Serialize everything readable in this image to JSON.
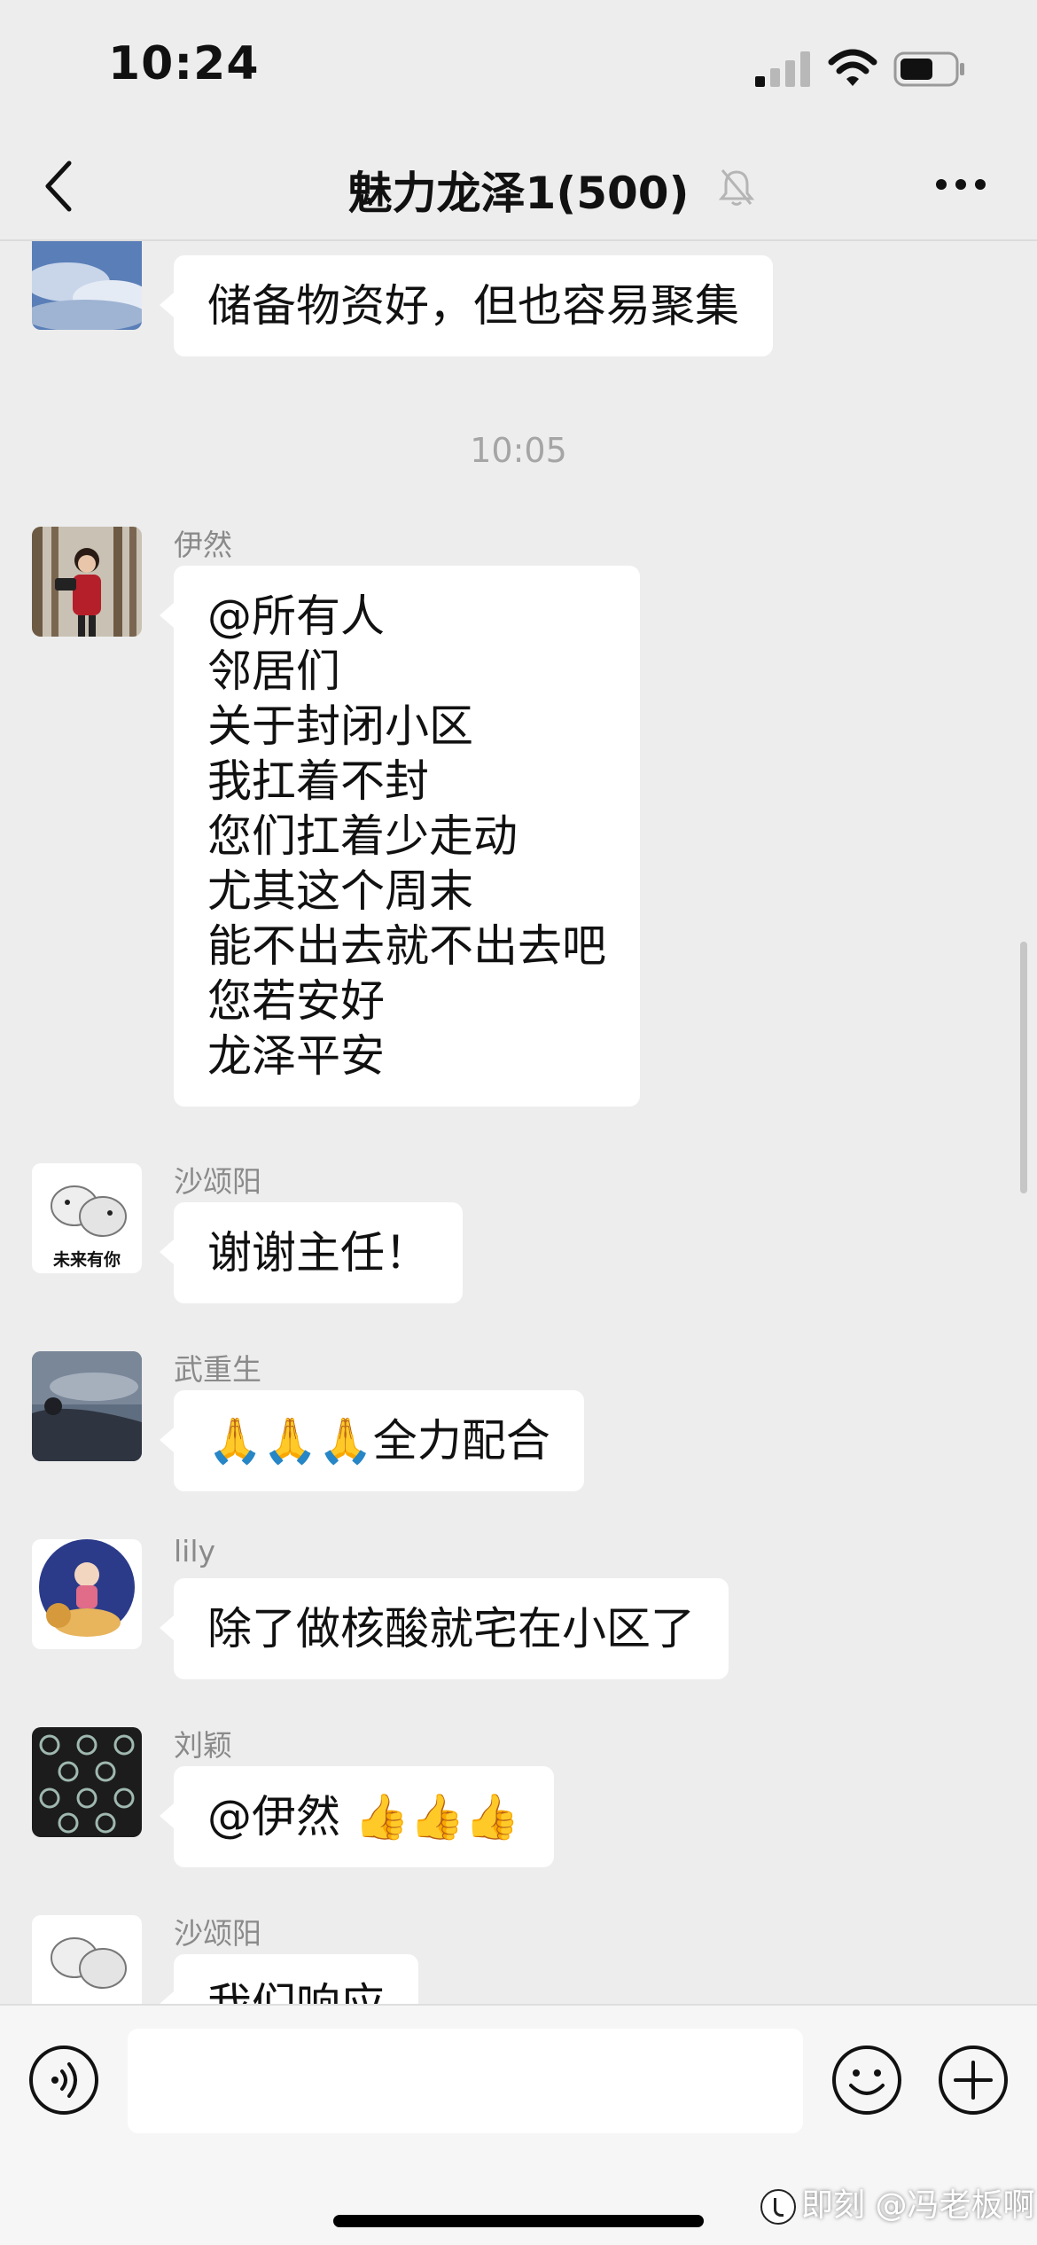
{
  "status_bar": {
    "time": "10:24"
  },
  "nav": {
    "title": "魅力龙泽1(500)"
  },
  "chat": {
    "partial_top": {
      "text": "储备物资好，但也容易聚集"
    },
    "timestamp": "10:05",
    "messages": [
      {
        "sender": "伊然",
        "text": "@所有人\n邻居们\n关于封闭小区\n我扛着不封\n您们扛着少走动\n尤其这个周末\n能不出去就不出去吧\n您若安好\n龙泽平安"
      },
      {
        "sender": "沙颂阳",
        "text": "谢谢主任！",
        "avatar_caption": "未来有你"
      },
      {
        "sender": "武重生",
        "text": "🙏🙏🙏全力配合"
      },
      {
        "sender": "lily",
        "text": "除了做核酸就宅在小区了"
      },
      {
        "sender": "刘颖",
        "text": "@伊然 👍👍👍"
      },
      {
        "sender": "沙颂阳",
        "text": "我们响应"
      }
    ]
  },
  "watermark": {
    "text": "即刻 @冯老板啊"
  }
}
